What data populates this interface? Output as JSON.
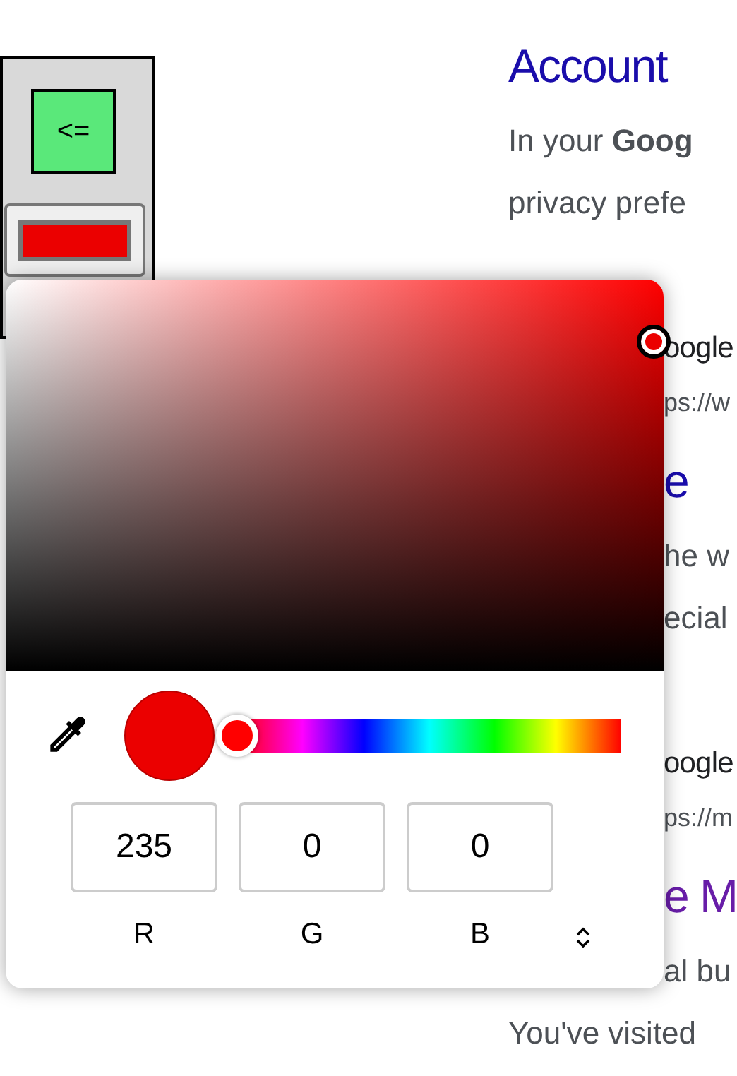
{
  "side_panel": {
    "back_button": "<="
  },
  "results": [
    {
      "kind": "title",
      "text": "Account",
      "visited": false
    },
    {
      "kind": "snippet",
      "text": "In your **Goog**"
    },
    {
      "kind": "snippet",
      "text": "privacy prefe"
    },
    {
      "kind": "site",
      "text": "oogle"
    },
    {
      "kind": "url",
      "text": "ps://w"
    },
    {
      "kind": "title",
      "text": "e",
      "visited": false
    },
    {
      "kind": "snippet",
      "text": "he w"
    },
    {
      "kind": "snippet",
      "text": "ecial"
    },
    {
      "kind": "site",
      "text": "oogle"
    },
    {
      "kind": "url",
      "text": "ps://m"
    },
    {
      "kind": "title",
      "text": "e M",
      "visited": true
    },
    {
      "kind": "snippet",
      "text": "al bu"
    },
    {
      "kind": "snippet",
      "text": "You've visited"
    }
  ],
  "color_picker": {
    "hue_slider": {
      "level": 0
    },
    "channels": [
      {
        "label": "R",
        "value": "235"
      },
      {
        "label": "G",
        "value": "0"
      },
      {
        "label": "B",
        "value": "0"
      }
    ]
  }
}
